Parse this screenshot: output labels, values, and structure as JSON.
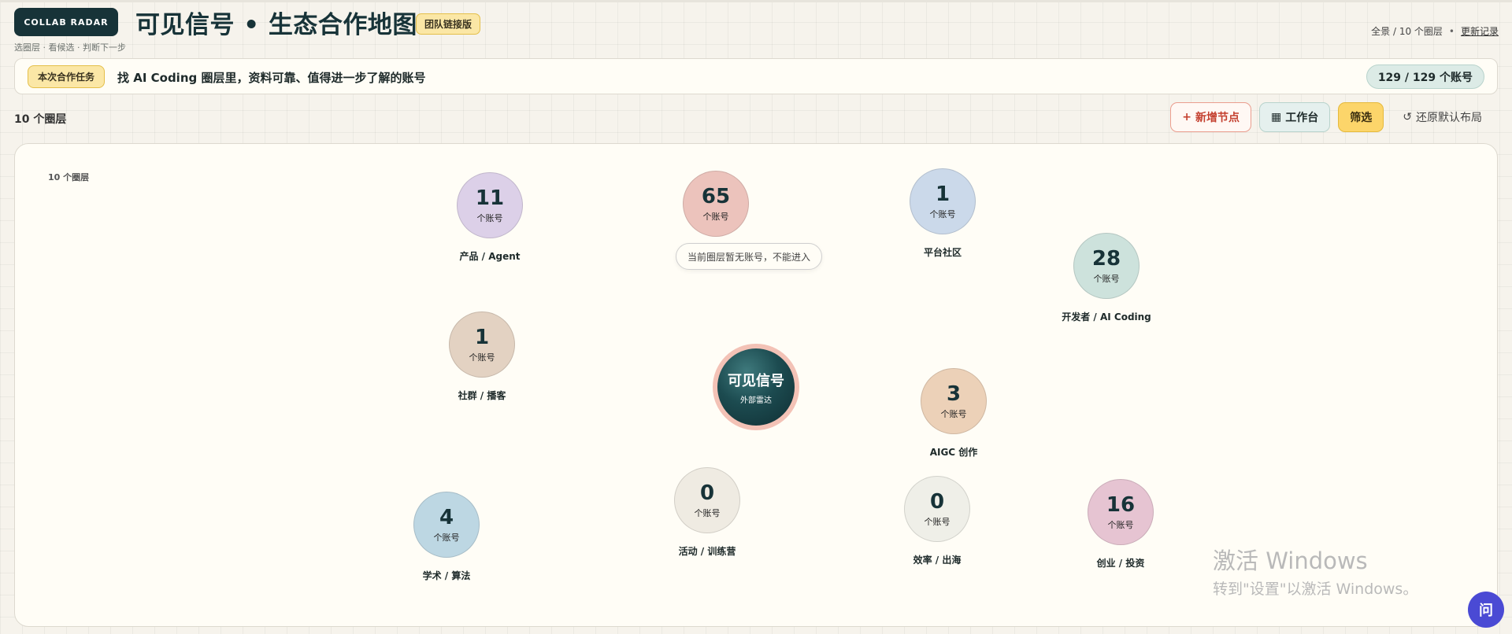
{
  "header": {
    "brand": "COLLAB RADAR",
    "title": "可见信号 • 生态合作地图",
    "edition_badge": "团队链接版",
    "subtitle": "选圈层 · 看候选 · 判断下一步",
    "scope": "全景 / 10 个圈层",
    "separator": "•",
    "changelog_link": "更新记录"
  },
  "task": {
    "badge": "本次合作任务",
    "text": "找 AI Coding 圈层里，资料可靠、值得进一步了解的账号",
    "count": "129 / 129 个账号"
  },
  "toolbar": {
    "layer_count": "10 个圈层",
    "add_node": "新增节点",
    "workbench": "工作台",
    "filter": "筛选",
    "reset_layout": "还原默认布局"
  },
  "canvas": {
    "label": "10 个圈层",
    "center": {
      "title": "可见信号",
      "subtitle": "外部雷达"
    },
    "tooltip": "当前圈层暂无账号，不能进入",
    "unit": "个账号",
    "nodes": [
      {
        "count": "11",
        "name": "产品 / Agent",
        "color": "#dcd0e8"
      },
      {
        "count": "65",
        "name": "",
        "color": "#ecc3bc"
      },
      {
        "count": "1",
        "name": "平台社区",
        "color": "#cbd9ea"
      },
      {
        "count": "28",
        "name": "开发者 / AI Coding",
        "color": "#cde2dc"
      },
      {
        "count": "1",
        "name": "社群 / 播客",
        "color": "#e3d2c2"
      },
      {
        "count": "3",
        "name": "AIGC 创作",
        "color": "#ecd1b8"
      },
      {
        "count": "0",
        "name": "活动 / 训练营",
        "color": "#efebe2"
      },
      {
        "count": "0",
        "name": "效率 / 出海",
        "color": "#efefe8"
      },
      {
        "count": "16",
        "name": "创业 / 投资",
        "color": "#e6c4d2"
      },
      {
        "count": "4",
        "name": "学术 / 算法",
        "color": "#bdd7e3"
      }
    ]
  },
  "watermark": {
    "line1": "激活 Windows",
    "line2": "转到\"设置\"以激活 Windows。"
  },
  "help_button": "问"
}
